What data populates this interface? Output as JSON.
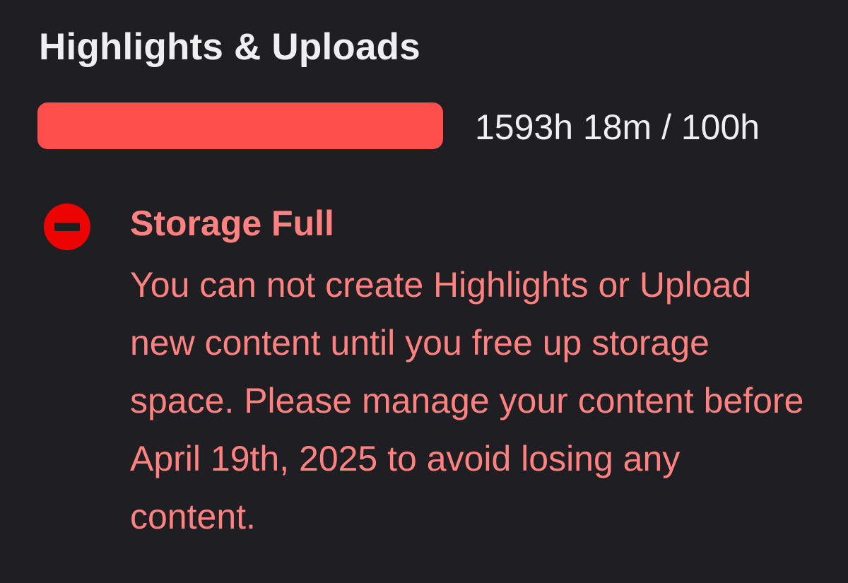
{
  "section": {
    "title": "Highlights & Uploads"
  },
  "usage": {
    "text": "1593h 18m / 100h",
    "fill_fraction": 1.0,
    "fill_color": "#ff4f4d",
    "track_color": "#3a3a3d"
  },
  "alert": {
    "icon": "do-not-enter-icon",
    "icon_color": "#eb0400",
    "title": "Storage Full",
    "message": "You can not create Highlights or Upload new content until you free up storage space. Please manage your content before April 19th, 2025 to avoid losing any content.",
    "text_color": "#ff8280"
  },
  "colors": {
    "background": "#1f1f23",
    "primary_text": "#efeff1"
  }
}
